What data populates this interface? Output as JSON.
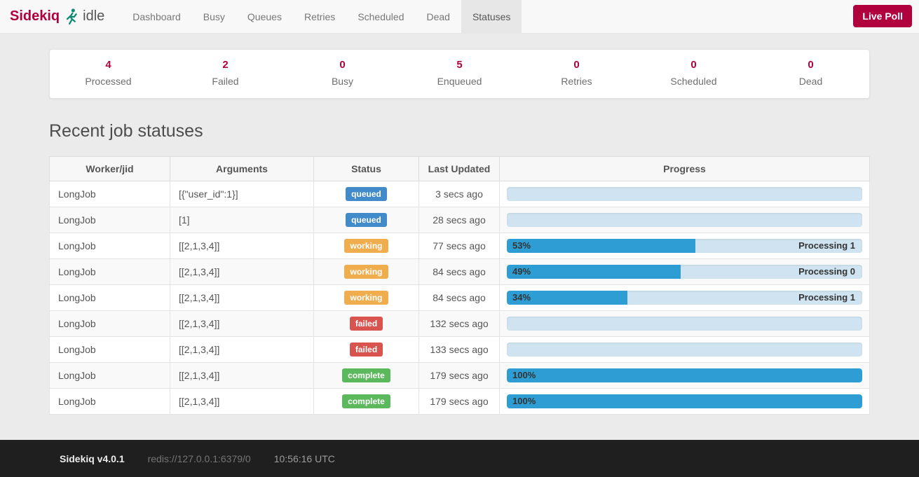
{
  "navbar": {
    "brand": "Sidekiq",
    "status": "idle",
    "items": [
      {
        "label": "Dashboard",
        "active": false
      },
      {
        "label": "Busy",
        "active": false
      },
      {
        "label": "Queues",
        "active": false
      },
      {
        "label": "Retries",
        "active": false
      },
      {
        "label": "Scheduled",
        "active": false
      },
      {
        "label": "Dead",
        "active": false
      },
      {
        "label": "Statuses",
        "active": true
      }
    ],
    "live_poll_label": "Live Poll"
  },
  "stats": [
    {
      "value": "4",
      "label": "Processed"
    },
    {
      "value": "2",
      "label": "Failed"
    },
    {
      "value": "0",
      "label": "Busy"
    },
    {
      "value": "5",
      "label": "Enqueued"
    },
    {
      "value": "0",
      "label": "Retries"
    },
    {
      "value": "0",
      "label": "Scheduled"
    },
    {
      "value": "0",
      "label": "Dead"
    }
  ],
  "main": {
    "heading": "Recent job statuses"
  },
  "table": {
    "headers": [
      "Worker/jid",
      "Arguments",
      "Status",
      "Last Updated",
      "Progress"
    ],
    "rows": [
      {
        "worker": "LongJob",
        "arguments": "[{\"user_id\":1}]",
        "status": "queued",
        "last_updated": "3 secs ago",
        "progress_pct": 0,
        "progress_label": "",
        "progress_message": ""
      },
      {
        "worker": "LongJob",
        "arguments": "[1]",
        "status": "queued",
        "last_updated": "28 secs ago",
        "progress_pct": 0,
        "progress_label": "",
        "progress_message": ""
      },
      {
        "worker": "LongJob",
        "arguments": "[[2,1,3,4]]",
        "status": "working",
        "last_updated": "77 secs ago",
        "progress_pct": 53,
        "progress_label": "53%",
        "progress_message": "Processing 1"
      },
      {
        "worker": "LongJob",
        "arguments": "[[2,1,3,4]]",
        "status": "working",
        "last_updated": "84 secs ago",
        "progress_pct": 49,
        "progress_label": "49%",
        "progress_message": "Processing 0"
      },
      {
        "worker": "LongJob",
        "arguments": "[[2,1,3,4]]",
        "status": "working",
        "last_updated": "84 secs ago",
        "progress_pct": 34,
        "progress_label": "34%",
        "progress_message": "Processing 1"
      },
      {
        "worker": "LongJob",
        "arguments": "[[2,1,3,4]]",
        "status": "failed",
        "last_updated": "132 secs ago",
        "progress_pct": 0,
        "progress_label": "",
        "progress_message": ""
      },
      {
        "worker": "LongJob",
        "arguments": "[[2,1,3,4]]",
        "status": "failed",
        "last_updated": "133 secs ago",
        "progress_pct": 0,
        "progress_label": "",
        "progress_message": ""
      },
      {
        "worker": "LongJob",
        "arguments": "[[2,1,3,4]]",
        "status": "complete",
        "last_updated": "179 secs ago",
        "progress_pct": 100,
        "progress_label": "100%",
        "progress_message": ""
      },
      {
        "worker": "LongJob",
        "arguments": "[[2,1,3,4]]",
        "status": "complete",
        "last_updated": "179 secs ago",
        "progress_pct": 100,
        "progress_label": "100%",
        "progress_message": ""
      }
    ]
  },
  "status_colors": {
    "queued": "#428bca",
    "working": "#f0ad4e",
    "failed": "#d9534f",
    "complete": "#5cb85c"
  },
  "colors": {
    "accent": "#b1003e",
    "progress_fill": "#2d9dd3",
    "progress_track": "#cfe4f0",
    "logo_green": "#0f8a74"
  },
  "footer": {
    "version": "Sidekiq v4.0.1",
    "redis_url": "redis://127.0.0.1:6379/0",
    "time": "10:56:16 UTC"
  }
}
